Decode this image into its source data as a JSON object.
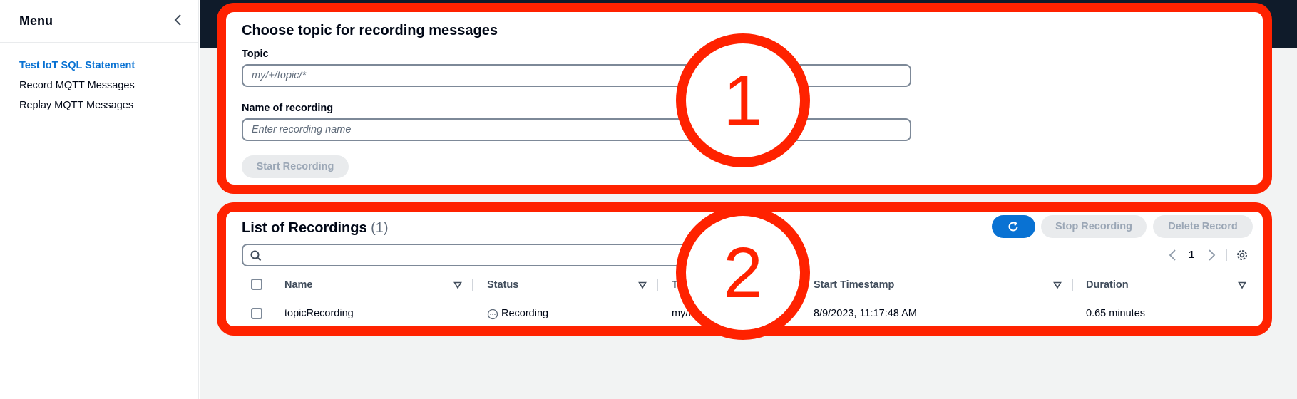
{
  "sidebar": {
    "title": "Menu",
    "items": [
      {
        "label": "Test IoT SQL Statement"
      },
      {
        "label": "Record MQTT Messages"
      },
      {
        "label": "Replay MQTT Messages"
      }
    ]
  },
  "record_section": {
    "title": "Choose topic for recording messages",
    "topic_label": "Topic",
    "topic_placeholder": "my/+/topic/*",
    "name_label": "Name of recording",
    "name_placeholder": "Enter recording name",
    "start_button": "Start Recording"
  },
  "recordings": {
    "title": "List of Recordings",
    "count": "(1)",
    "stop_button": "Stop Recording",
    "delete_button": "Delete Record",
    "page_number": "1",
    "columns": [
      "Name",
      "Status",
      "To",
      "Start Timestamp",
      "Duration"
    ],
    "rows": [
      {
        "name": "topicRecording",
        "status": "Recording",
        "topic": "my/to",
        "start": "8/9/2023, 11:17:48 AM",
        "duration": "0.65 minutes"
      }
    ]
  },
  "annotations": [
    "1",
    "2"
  ],
  "colors": {
    "accent": "#0972d3",
    "annotation": "#ff2200",
    "header_dark": "#0f1b2a"
  }
}
